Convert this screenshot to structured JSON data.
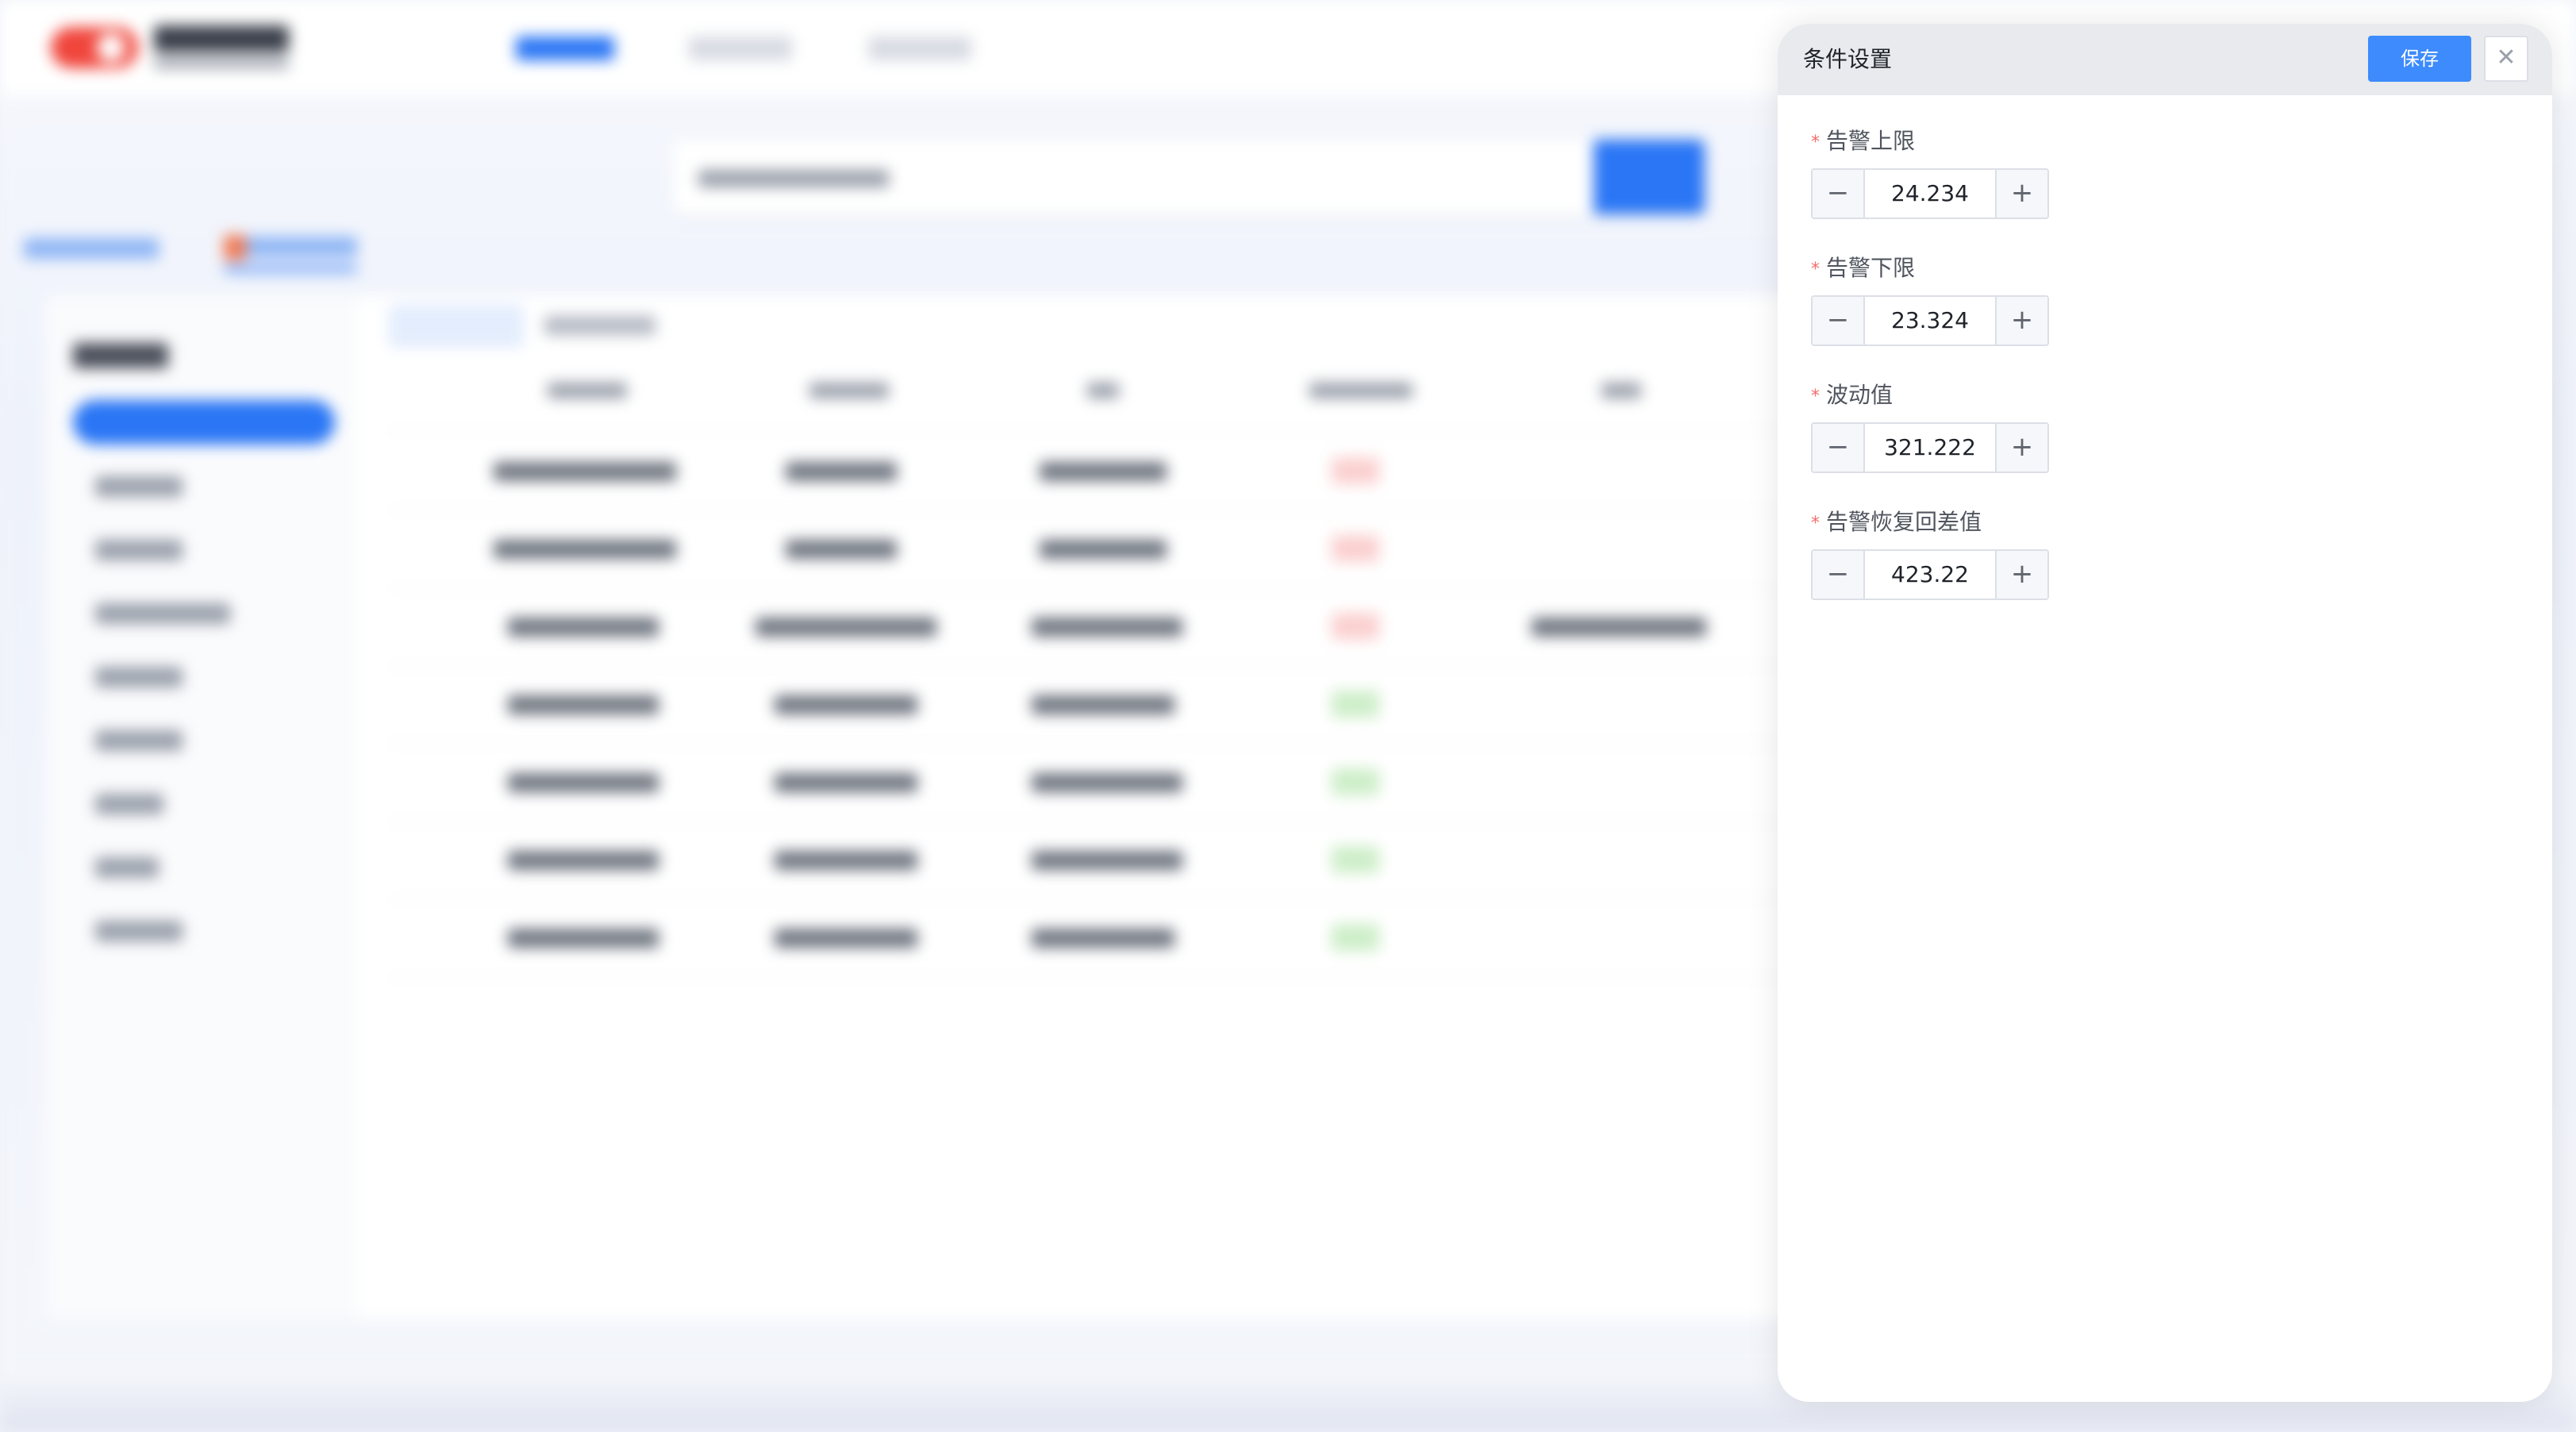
{
  "drawer": {
    "title": "条件设置",
    "save_label": "保存",
    "close_icon": "close-icon",
    "fields": [
      {
        "label": "告警上限",
        "required": true,
        "value": "24.234",
        "minus": "−",
        "plus": "+"
      },
      {
        "label": "告警下限",
        "required": true,
        "value": "23.324",
        "minus": "−",
        "plus": "+"
      },
      {
        "label": "波动值",
        "required": true,
        "value": "321.222",
        "minus": "−",
        "plus": "+"
      },
      {
        "label": "告警恢复回差值",
        "required": true,
        "value": "423.22",
        "minus": "−",
        "plus": "+"
      }
    ]
  },
  "colors": {
    "accent": "#3d8bfd",
    "required_mark": "#f56c6c",
    "header_bg": "#e8eaee"
  }
}
